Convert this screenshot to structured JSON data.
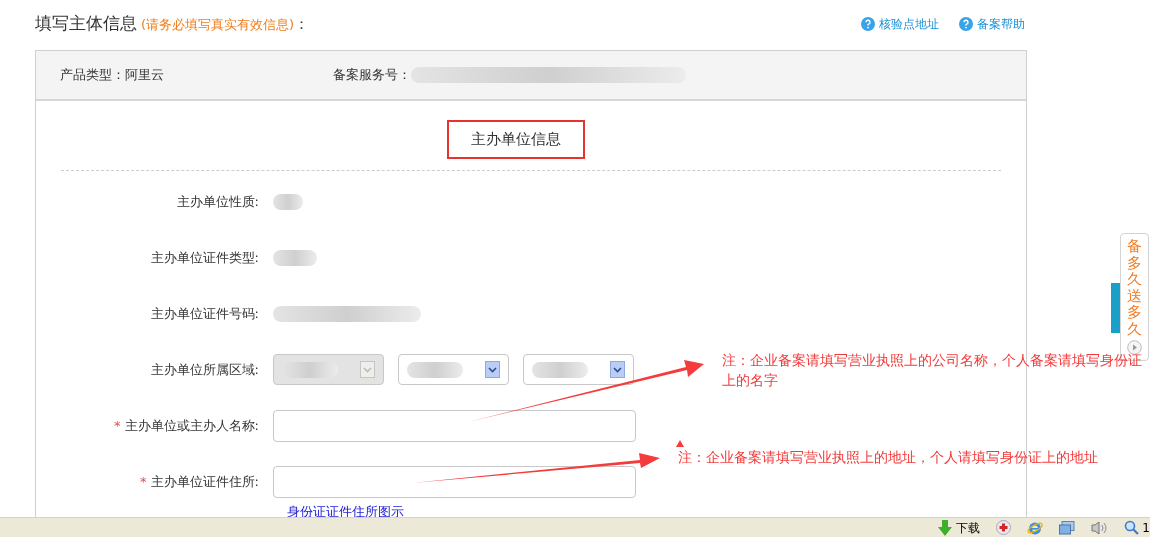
{
  "header": {
    "title": "填写主体信息",
    "note": "(请务必填写真实有效信息)",
    "colon": "：",
    "links": [
      "核验点地址",
      "备案帮助"
    ]
  },
  "info_bar": [
    {
      "label": "产品类型：",
      "kind": "text",
      "value": "阿里云"
    },
    {
      "label": "备案服务号：",
      "kind": "blurred"
    }
  ],
  "section_title": "主办单位信息",
  "fields": [
    {
      "label": "主办单位性质:",
      "kind": "blurred"
    },
    {
      "label": "主办单位证件类型:",
      "kind": "blurred"
    },
    {
      "label": "主办单位证件号码:",
      "kind": "blurred"
    },
    {
      "label": "主办单位所属区域:",
      "kind": "selects",
      "selects": [
        {
          "disabled": true
        },
        {
          "disabled": false
        },
        {
          "disabled": false
        }
      ]
    },
    {
      "label": "主办单位或主办人名称:",
      "kind": "input",
      "mark": "*"
    },
    {
      "label": "主办单位证件住所:",
      "kind": "input",
      "mark": "*"
    }
  ],
  "link": "身份证证件住所图示",
  "annotations": [
    {
      "text": "注：企业备案请填写营业执照上的公司名称，个人备案请填写身份证上的名字"
    },
    {
      "text": "注：企业备案请填写营业执照上的地址，个人请填写身份证上的地址"
    }
  ],
  "side_widget": {
    "text": "备多久送多久"
  },
  "status_bar": {
    "download": "下载",
    "zoom": "1"
  }
}
